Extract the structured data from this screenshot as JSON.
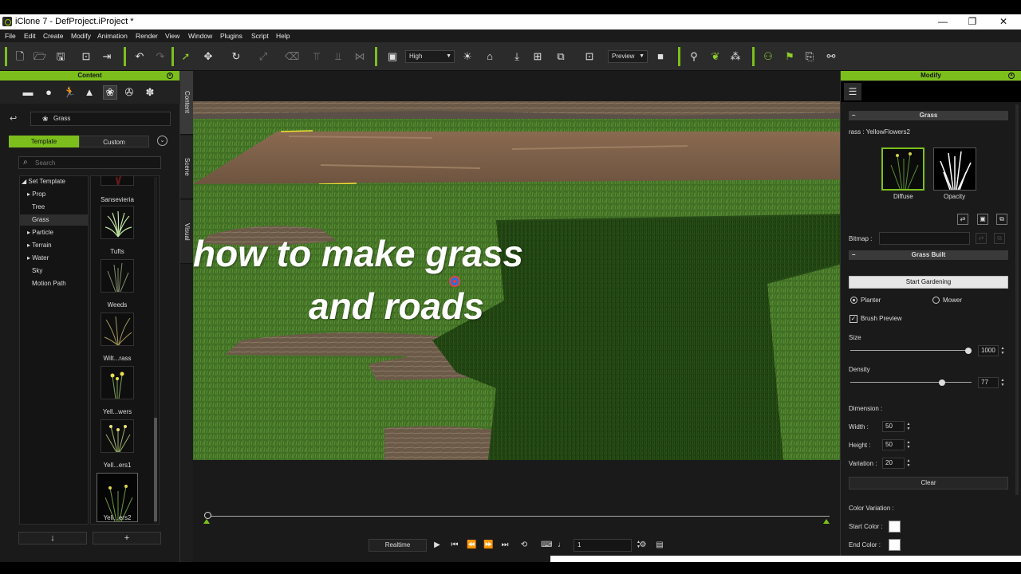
{
  "window": {
    "title": "iClone 7 - DefProject.iProject *",
    "minimize": "—",
    "maximize": "❐",
    "close": "✕"
  },
  "menu": [
    "File",
    "Edit",
    "Create",
    "Modify",
    "Animation",
    "Render",
    "View",
    "Window",
    "Plugins",
    "Script",
    "Help"
  ],
  "toolbar": {
    "quality": "High",
    "preview": "Preview"
  },
  "content_panel": {
    "header": "Content",
    "path": "Grass",
    "tabs": {
      "template": "Template",
      "custom": "Custom"
    },
    "search_placeholder": "Search",
    "tree": [
      "Set Template",
      "Prop",
      "Tree",
      "Grass",
      "Particle",
      "Terrain",
      "Water",
      "Sky",
      "Motion Path"
    ],
    "selected_tree_item": "Grass",
    "assets": [
      "Sansevieria",
      "Tufts",
      "Weeds",
      "Wilt...rass",
      "Yell...wers",
      "Yell...ers1",
      "Yell...ers2"
    ],
    "selected_asset": "Yell...ers2",
    "down_button": "↓",
    "add_button": "+"
  },
  "side_tabs": [
    "Content",
    "Scene",
    "Visual"
  ],
  "viewport": {
    "overlay_line1": "how to make grass",
    "overlay_line2": "and roads"
  },
  "playback": {
    "realtime_label": "Realtime",
    "frame": "1"
  },
  "modify_panel": {
    "header": "Modify",
    "grass_section": "Grass",
    "grass_name_label": "rass :",
    "grass_name": "YellowFlowers2",
    "diffuse_label": "Diffuse",
    "opacity_label": "Opacity",
    "bitmap_label": "Bitmap :",
    "grass_built_section": "Grass Built",
    "start_gardening": "Start Gardening",
    "planter": "Planter",
    "mower": "Mower",
    "brush_preview": "Brush Preview",
    "size_label": "Size",
    "size_value": "1000",
    "size_fraction": 1.0,
    "density_label": "Density",
    "density_value": "77",
    "density_fraction": 0.77,
    "dimension_label": "Dimension :",
    "width_label": "Width :",
    "width_value": "50",
    "height_label": "Height :",
    "height_value": "50",
    "variation_label": "Variation :",
    "variation_value": "20",
    "clear": "Clear",
    "color_variation_label": "Color Variation :",
    "start_color_label": "Start Color :",
    "end_color_label": "End Color :",
    "start_color": "#ffffff",
    "end_color": "#ffffff"
  },
  "colors": {
    "accent": "#7cbf1c",
    "panel_bg": "#1a1a1a"
  }
}
